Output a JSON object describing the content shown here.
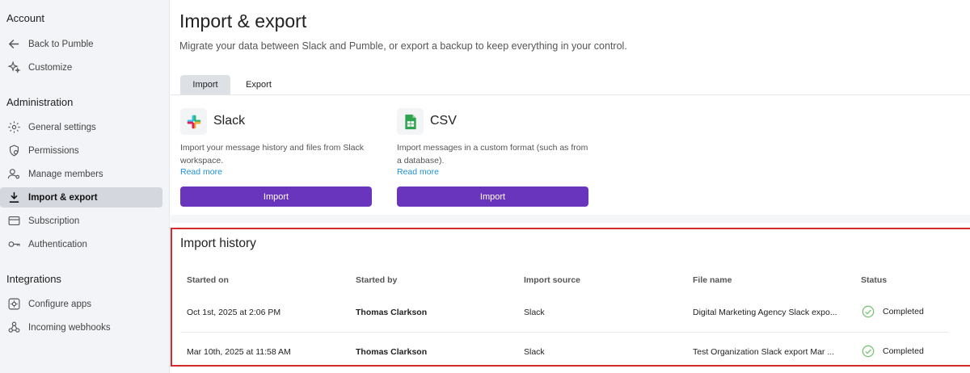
{
  "sidebar": {
    "sections": [
      {
        "title": "Account",
        "items": [
          {
            "label": "Back to Pumble",
            "icon": "arrow-left-icon"
          },
          {
            "label": "Customize",
            "icon": "sparkles-icon"
          }
        ]
      },
      {
        "title": "Administration",
        "items": [
          {
            "label": "General settings",
            "icon": "gear-icon"
          },
          {
            "label": "Permissions",
            "icon": "shield-icon"
          },
          {
            "label": "Manage members",
            "icon": "user-gear-icon"
          },
          {
            "label": "Import & export",
            "icon": "download-icon",
            "active": true
          },
          {
            "label": "Subscription",
            "icon": "credit-card-icon"
          },
          {
            "label": "Authentication",
            "icon": "key-icon"
          }
        ]
      },
      {
        "title": "Integrations",
        "items": [
          {
            "label": "Configure apps",
            "icon": "apps-gear-icon"
          },
          {
            "label": "Incoming webhooks",
            "icon": "webhook-icon"
          }
        ]
      }
    ]
  },
  "page": {
    "title": "Import & export",
    "description": "Migrate your data between Slack and Pumble, or export a backup to keep everything in your control."
  },
  "tabs": [
    {
      "label": "Import",
      "active": true
    },
    {
      "label": "Export",
      "active": false
    }
  ],
  "cards": [
    {
      "name": "Slack",
      "icon": "slack-logo-icon",
      "description": "Import your message history and files from Slack workspace.",
      "more": "Read more",
      "button": "Import"
    },
    {
      "name": "CSV",
      "icon": "csv-file-icon",
      "description": "Import messages in a custom format (such as from a database).",
      "more": "Read more",
      "button": "Import"
    }
  ],
  "history": {
    "title": "Import history",
    "columns": [
      "Started on",
      "Started by",
      "Import source",
      "File name",
      "Status"
    ],
    "rows": [
      {
        "started_on": "Oct 1st, 2025 at 2:06 PM",
        "started_by": "Thomas Clarkson",
        "source": "Slack",
        "file_name": "Digital Marketing Agency Slack expo...",
        "status": "Completed"
      },
      {
        "started_on": "Mar 10th, 2025 at 11:58 AM",
        "started_by": "Thomas Clarkson",
        "source": "Slack",
        "file_name": "Test Organization Slack export Mar ...",
        "status": "Completed"
      }
    ]
  },
  "colors": {
    "accent": "#6a35bd",
    "link": "#1f8fd1",
    "status_ok": "#7cc576",
    "highlight_border": "#d42a2a"
  }
}
